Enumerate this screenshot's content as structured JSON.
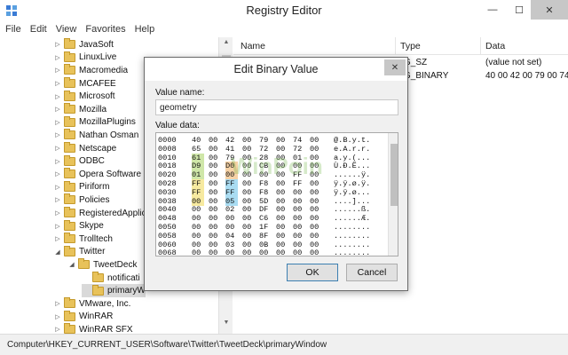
{
  "window": {
    "title": "Registry Editor",
    "minimize": "—",
    "maximize": "☐",
    "close": "✕"
  },
  "menu": [
    "File",
    "Edit",
    "View",
    "Favorites",
    "Help"
  ],
  "tree": {
    "items": [
      {
        "label": "JavaSoft",
        "arrow": "▷"
      },
      {
        "label": "LinuxLive",
        "arrow": "▷"
      },
      {
        "label": "Macromedia",
        "arrow": "▷"
      },
      {
        "label": "MCAFEE",
        "arrow": "▷"
      },
      {
        "label": "Microsoft",
        "arrow": "▷"
      },
      {
        "label": "Mozilla",
        "arrow": "▷"
      },
      {
        "label": "MozillaPlugins",
        "arrow": "▷"
      },
      {
        "label": "Nathan Osman",
        "arrow": "▷"
      },
      {
        "label": "Netscape",
        "arrow": "▷"
      },
      {
        "label": "ODBC",
        "arrow": "▷"
      },
      {
        "label": "Opera Software",
        "arrow": "▷"
      },
      {
        "label": "Piriform",
        "arrow": "▷"
      },
      {
        "label": "Policies",
        "arrow": "▷"
      },
      {
        "label": "RegisteredApplic",
        "arrow": "▷"
      },
      {
        "label": "Skype",
        "arrow": "▷"
      },
      {
        "label": "Trolltech",
        "arrow": "▷"
      },
      {
        "label": "Twitter",
        "arrow": "◢"
      },
      {
        "label": "TweetDeck",
        "arrow": "◢"
      },
      {
        "label": "notificati",
        "arrow": ""
      },
      {
        "label": "primaryW",
        "arrow": ""
      },
      {
        "label": "VMware, Inc.",
        "arrow": "▷"
      },
      {
        "label": "WinRAR",
        "arrow": "▷"
      },
      {
        "label": "WinRAR SFX",
        "arrow": "▷"
      }
    ]
  },
  "list": {
    "columns": [
      "Name",
      "Type",
      "Data"
    ],
    "rows": [
      {
        "type": "G_SZ",
        "data": "(value not set)"
      },
      {
        "type": "G_BINARY",
        "data": "40 00 42 00 79 00 74"
      }
    ]
  },
  "status": {
    "path": "Computer\\HKEY_CURRENT_USER\\Software\\Twitter\\TweetDeck\\primaryWindow"
  },
  "dialog": {
    "title": "Edit Binary Value",
    "close": "✕",
    "value_name_label": "Value name:",
    "value_name": "geometry",
    "value_data_label": "Value data:",
    "ok": "OK",
    "cancel": "Cancel",
    "hex_rows": [
      {
        "offset": "0000",
        "bytes": [
          "40",
          "00",
          "42",
          "00",
          "79",
          "00",
          "74",
          "00"
        ],
        "ascii": "@.B.y.t."
      },
      {
        "offset": "0008",
        "bytes": [
          "65",
          "00",
          "41",
          "00",
          "72",
          "00",
          "72",
          "00"
        ],
        "ascii": "e.A.r.r."
      },
      {
        "offset": "0010",
        "bytes": [
          "61",
          "00",
          "79",
          "00",
          "28",
          "00",
          "01",
          "00"
        ],
        "ascii": "a.y.(..."
      },
      {
        "offset": "0018",
        "bytes": [
          "D9",
          "00",
          "D0",
          "00",
          "CB",
          "00",
          "00",
          "00"
        ],
        "ascii": "Ù.Ð.Ë..."
      },
      {
        "offset": "0020",
        "bytes": [
          "01",
          "00",
          "00",
          "00",
          "00",
          "00",
          "FF",
          "00"
        ],
        "ascii": "......ÿ."
      },
      {
        "offset": "0028",
        "bytes": [
          "FF",
          "00",
          "FF",
          "00",
          "F8",
          "00",
          "FF",
          "00"
        ],
        "ascii": "ÿ.ÿ.ø.ÿ."
      },
      {
        "offset": "0030",
        "bytes": [
          "FF",
          "00",
          "FF",
          "00",
          "F8",
          "00",
          "00",
          "00"
        ],
        "ascii": "ÿ.ÿ.ø..."
      },
      {
        "offset": "0038",
        "bytes": [
          "00",
          "00",
          "05",
          "00",
          "5D",
          "00",
          "00",
          "00"
        ],
        "ascii": "....]..."
      },
      {
        "offset": "0040",
        "bytes": [
          "00",
          "00",
          "02",
          "00",
          "DF",
          "00",
          "00",
          "00"
        ],
        "ascii": "......ß."
      },
      {
        "offset": "0048",
        "bytes": [
          "00",
          "00",
          "00",
          "00",
          "C6",
          "00",
          "00",
          "00"
        ],
        "ascii": "......Æ."
      },
      {
        "offset": "0050",
        "bytes": [
          "00",
          "00",
          "00",
          "00",
          "1F",
          "00",
          "00",
          "00"
        ],
        "ascii": "........"
      },
      {
        "offset": "0058",
        "bytes": [
          "00",
          "00",
          "04",
          "00",
          "8F",
          "00",
          "00",
          "00"
        ],
        "ascii": "........"
      },
      {
        "offset": "0060",
        "bytes": [
          "00",
          "00",
          "03",
          "00",
          "0B",
          "00",
          "00",
          "00"
        ],
        "ascii": "........"
      },
      {
        "offset": "0068",
        "bytes": [
          "00",
          "00",
          "00",
          "00",
          "00",
          "00",
          "00",
          "00"
        ],
        "ascii": "........"
      }
    ],
    "highlight_colors": {
      "green": "#cfe7a8",
      "orange": "#f6d2a6",
      "yellow": "#f7eaa0",
      "cyan": "#a9dcf2"
    }
  },
  "watermark": {
    "text": "WinPoin"
  }
}
